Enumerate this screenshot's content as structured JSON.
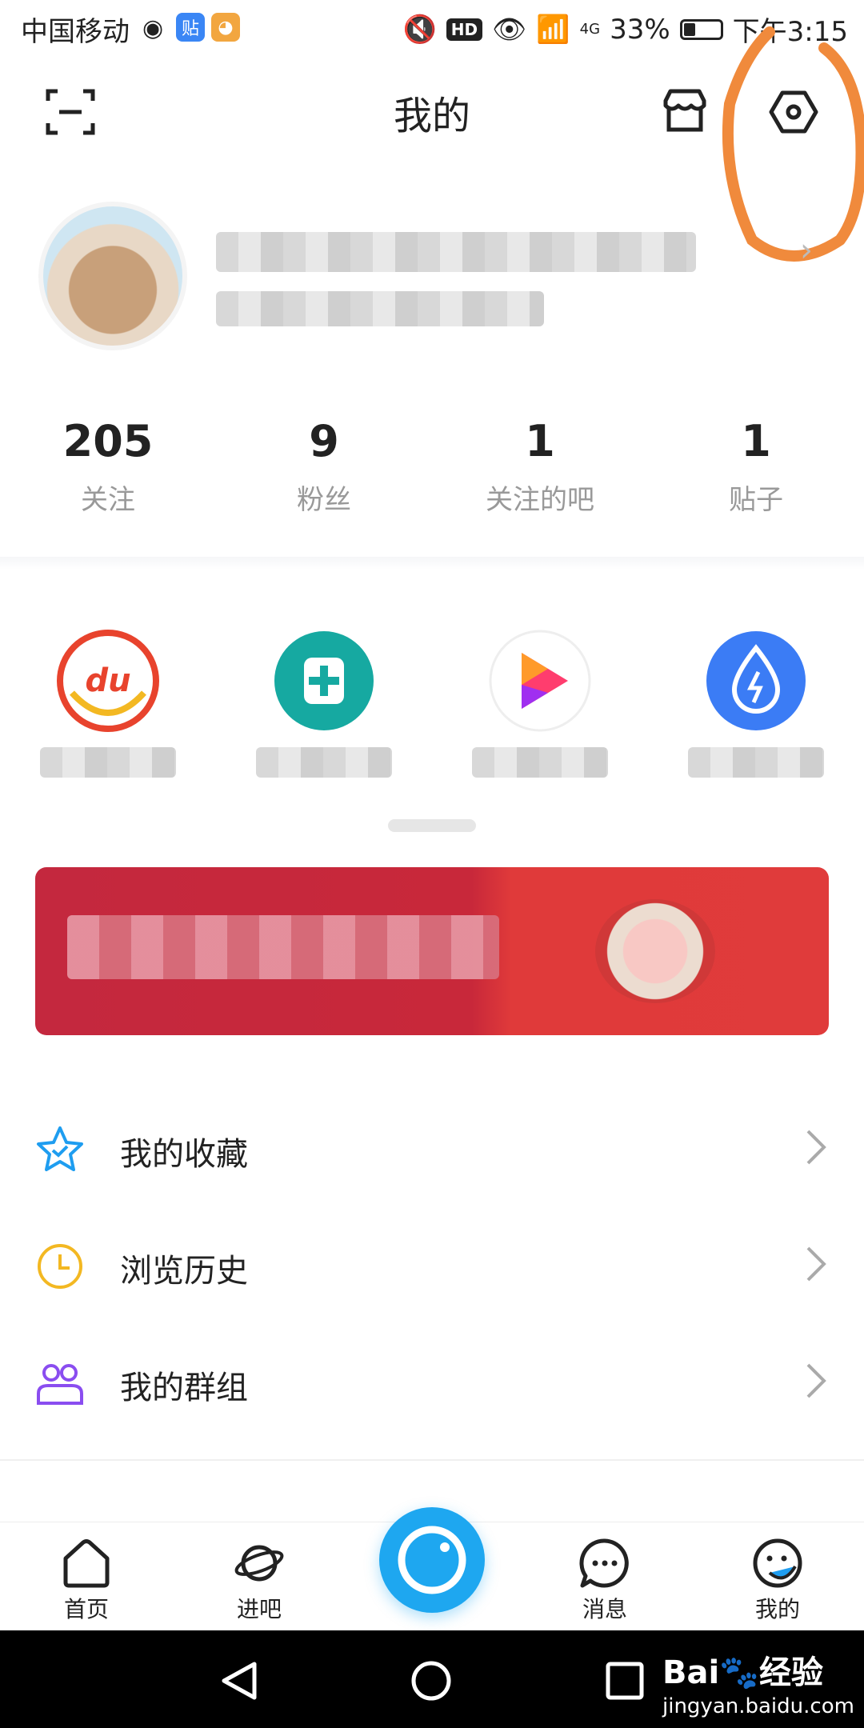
{
  "status_bar": {
    "carrier": "中国移动",
    "tieba_badge": "贴",
    "network": "4G",
    "battery": "33%",
    "time": "下午3:15"
  },
  "header": {
    "title": "我的"
  },
  "stats": [
    {
      "value": "205",
      "label": "关注"
    },
    {
      "value": "9",
      "label": "粉丝"
    },
    {
      "value": "1",
      "label": "关注的吧"
    },
    {
      "value": "1",
      "label": "贴子"
    }
  ],
  "apps": [
    {
      "icon": "du-app-icon",
      "color": "#e8432d"
    },
    {
      "icon": "health-app-icon",
      "color": "#16a9a1"
    },
    {
      "icon": "video-play-app-icon",
      "color": "#ff3d6e"
    },
    {
      "icon": "water-drop-app-icon",
      "color": "#3b7cf5"
    }
  ],
  "menu": [
    {
      "label": "我的收藏",
      "icon": "star-icon",
      "color": "#1e9df0"
    },
    {
      "label": "浏览历史",
      "icon": "clock-icon",
      "color": "#f3b822"
    },
    {
      "label": "我的群组",
      "icon": "group-icon",
      "color": "#8a4df0"
    }
  ],
  "bottom_nav": [
    {
      "label": "首页",
      "icon": "home-icon"
    },
    {
      "label": "进吧",
      "icon": "planet-icon"
    },
    {
      "label": "消息",
      "icon": "message-icon"
    },
    {
      "label": "我的",
      "icon": "profile-icon"
    }
  ],
  "watermark": {
    "brand": "Bai🐾经验",
    "url": "jingyan.baidu.com"
  },
  "colors": {
    "accent": "#1ea7f0",
    "annotation": "#f08a3c"
  }
}
